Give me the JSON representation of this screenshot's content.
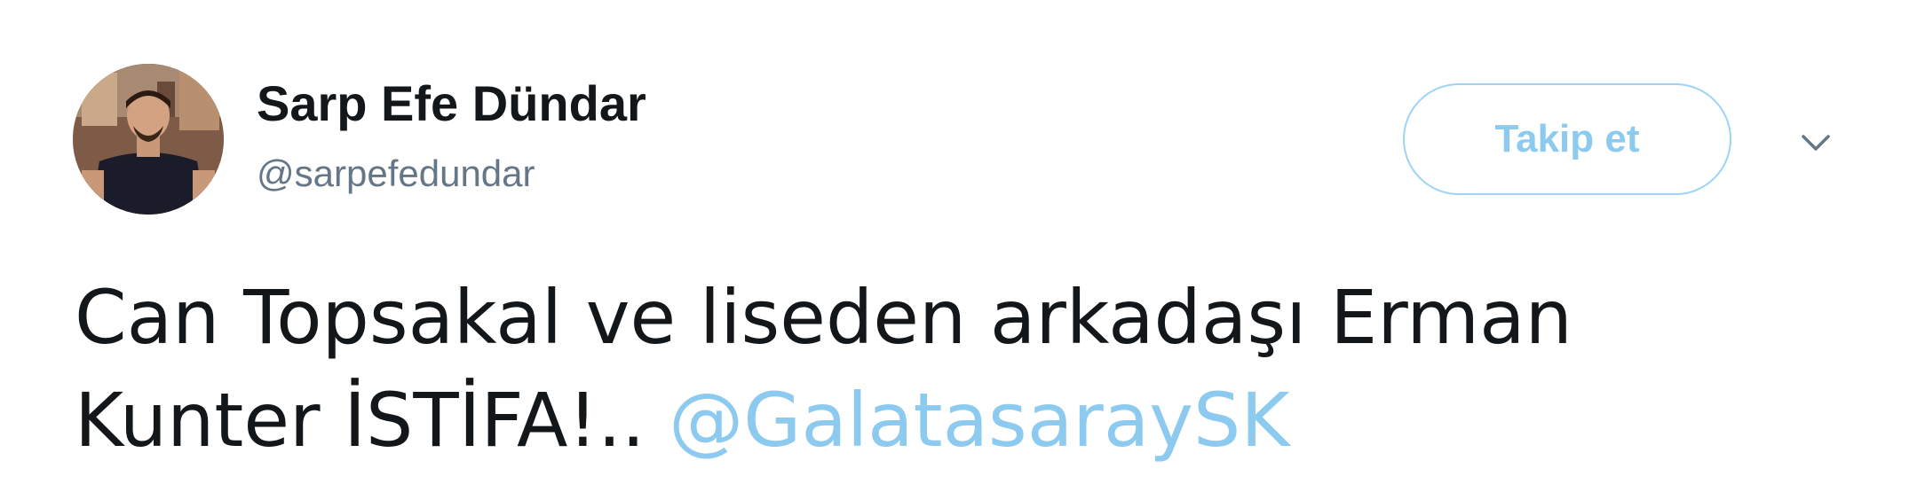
{
  "tweet": {
    "author_name": "Sarp Efe Dündar",
    "author_handle": "@sarpefedundar",
    "follow_label": "Takip et",
    "text_line_1": "Can Topsakal ve liseden arkadaşı Erman",
    "text_line_2_prefix": "Kunter İSTİFA!.. ",
    "mention": "@GalatasaraySK",
    "caret_icon": "chevron-down-icon",
    "colors": {
      "name": "#14171a",
      "handle": "#657786",
      "link": "#8ccaf0",
      "follow_border": "#9dd4f6"
    }
  }
}
